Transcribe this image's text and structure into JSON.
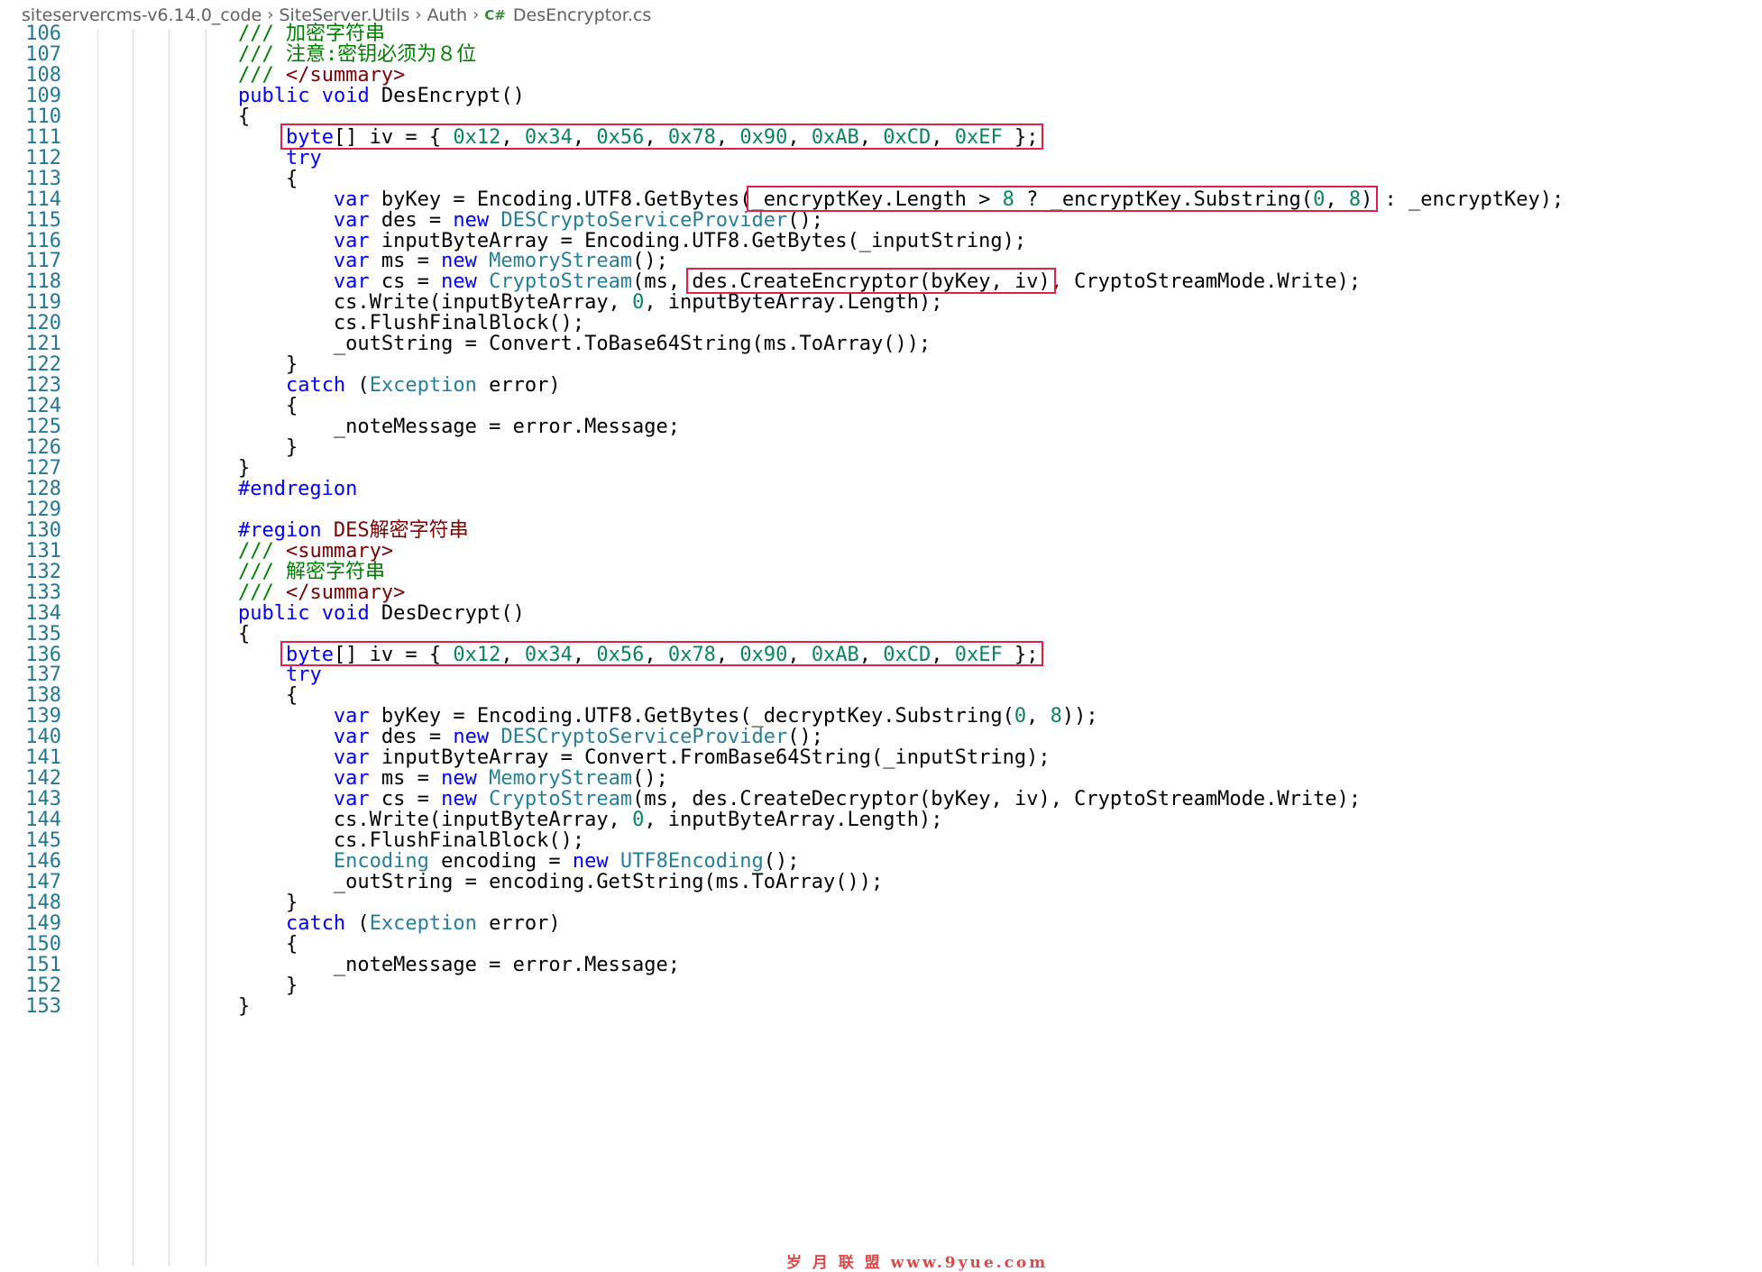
{
  "breadcrumb": {
    "items": [
      "siteservercms-v6.14.0_code",
      "SiteServer.Utils",
      "Auth"
    ],
    "file_icon": "C#",
    "file": "DesEncryptor.cs"
  },
  "colors": {
    "keyword": "#0000ff",
    "type": "#267f99",
    "comment": "#008000",
    "xml_tag": "#800000",
    "number": "#098658",
    "line_number": "#237893",
    "highlight_box": "#e3204a"
  },
  "lines": [
    {
      "n": "106",
      "t": [
        [
          "cm",
          "        /// 加密字符串"
        ]
      ]
    },
    {
      "n": "107",
      "t": [
        [
          "cm",
          "        /// 注意:密钥必须为８位"
        ]
      ]
    },
    {
      "n": "108",
      "t": [
        [
          "cm",
          "        /// "
        ],
        [
          "tag",
          "</summary>"
        ]
      ]
    },
    {
      "n": "109",
      "t": [
        [
          "p",
          "        "
        ],
        [
          "kw",
          "public"
        ],
        [
          "p",
          " "
        ],
        [
          "kw",
          "void"
        ],
        [
          "p",
          " DesEncrypt()"
        ]
      ]
    },
    {
      "n": "110",
      "t": [
        [
          "p",
          "        {"
        ]
      ]
    },
    {
      "n": "111",
      "t": [
        [
          "p",
          "            "
        ],
        [
          "kw",
          "byte"
        ],
        [
          "p",
          "[] iv = { "
        ],
        [
          "num",
          "0x12"
        ],
        [
          "p",
          ", "
        ],
        [
          "num",
          "0x34"
        ],
        [
          "p",
          ", "
        ],
        [
          "num",
          "0x56"
        ],
        [
          "p",
          ", "
        ],
        [
          "num",
          "0x78"
        ],
        [
          "p",
          ", "
        ],
        [
          "num",
          "0x90"
        ],
        [
          "p",
          ", "
        ],
        [
          "num",
          "0xAB"
        ],
        [
          "p",
          ", "
        ],
        [
          "num",
          "0xCD"
        ],
        [
          "p",
          ", "
        ],
        [
          "num",
          "0xEF"
        ],
        [
          "p",
          " };"
        ]
      ]
    },
    {
      "n": "112",
      "t": [
        [
          "p",
          "            "
        ],
        [
          "kw",
          "try"
        ]
      ]
    },
    {
      "n": "113",
      "t": [
        [
          "p",
          "            {"
        ]
      ]
    },
    {
      "n": "114",
      "t": [
        [
          "p",
          "                "
        ],
        [
          "kw",
          "var"
        ],
        [
          "p",
          " byKey = Encoding.UTF8.GetBytes(_encryptKey.Length > "
        ],
        [
          "num",
          "8"
        ],
        [
          "p",
          " ? _encryptKey.Substring("
        ],
        [
          "num",
          "0"
        ],
        [
          "p",
          ", "
        ],
        [
          "num",
          "8"
        ],
        [
          "p",
          ") : _encryptKey);"
        ]
      ]
    },
    {
      "n": "115",
      "t": [
        [
          "p",
          "                "
        ],
        [
          "kw",
          "var"
        ],
        [
          "p",
          " des = "
        ],
        [
          "kw",
          "new"
        ],
        [
          "p",
          " "
        ],
        [
          "cls",
          "DESCryptoServiceProvider"
        ],
        [
          "p",
          "();"
        ]
      ]
    },
    {
      "n": "116",
      "t": [
        [
          "p",
          "                "
        ],
        [
          "kw",
          "var"
        ],
        [
          "p",
          " inputByteArray = Encoding.UTF8.GetBytes(_inputString);"
        ]
      ]
    },
    {
      "n": "117",
      "t": [
        [
          "p",
          "                "
        ],
        [
          "kw",
          "var"
        ],
        [
          "p",
          " ms = "
        ],
        [
          "kw",
          "new"
        ],
        [
          "p",
          " "
        ],
        [
          "cls",
          "MemoryStream"
        ],
        [
          "p",
          "();"
        ]
      ]
    },
    {
      "n": "118",
      "t": [
        [
          "p",
          "                "
        ],
        [
          "kw",
          "var"
        ],
        [
          "p",
          " cs = "
        ],
        [
          "kw",
          "new"
        ],
        [
          "p",
          " "
        ],
        [
          "cls",
          "CryptoStream"
        ],
        [
          "p",
          "(ms, des.CreateEncryptor(byKey, iv), CryptoStreamMode.Write);"
        ]
      ]
    },
    {
      "n": "119",
      "t": [
        [
          "p",
          "                cs.Write(inputByteArray, "
        ],
        [
          "num",
          "0"
        ],
        [
          "p",
          ", inputByteArray.Length);"
        ]
      ]
    },
    {
      "n": "120",
      "t": [
        [
          "p",
          "                cs.FlushFinalBlock();"
        ]
      ]
    },
    {
      "n": "121",
      "t": [
        [
          "p",
          "                _outString = Convert.ToBase64String(ms.ToArray());"
        ]
      ]
    },
    {
      "n": "122",
      "t": [
        [
          "p",
          "            }"
        ]
      ]
    },
    {
      "n": "123",
      "t": [
        [
          "p",
          "            "
        ],
        [
          "kw",
          "catch"
        ],
        [
          "p",
          " ("
        ],
        [
          "cls",
          "Exception"
        ],
        [
          "p",
          " error)"
        ]
      ]
    },
    {
      "n": "124",
      "t": [
        [
          "p",
          "            {"
        ]
      ]
    },
    {
      "n": "125",
      "t": [
        [
          "p",
          "                _noteMessage = error.Message;"
        ]
      ]
    },
    {
      "n": "126",
      "t": [
        [
          "p",
          "            }"
        ]
      ]
    },
    {
      "n": "127",
      "t": [
        [
          "p",
          "        }"
        ]
      ]
    },
    {
      "n": "128",
      "t": [
        [
          "kw",
          "        #endregion"
        ]
      ]
    },
    {
      "n": "129",
      "t": [
        [
          "p",
          ""
        ]
      ]
    },
    {
      "n": "130",
      "t": [
        [
          "kw",
          "        #region"
        ],
        [
          "tag",
          " DES解密字符串"
        ]
      ]
    },
    {
      "n": "131",
      "t": [
        [
          "cm",
          "        /// "
        ],
        [
          "tag",
          "<summary>"
        ]
      ]
    },
    {
      "n": "132",
      "t": [
        [
          "cm",
          "        /// 解密字符串"
        ]
      ]
    },
    {
      "n": "133",
      "t": [
        [
          "cm",
          "        /// "
        ],
        [
          "tag",
          "</summary>"
        ]
      ]
    },
    {
      "n": "134",
      "t": [
        [
          "p",
          "        "
        ],
        [
          "kw",
          "public"
        ],
        [
          "p",
          " "
        ],
        [
          "kw",
          "void"
        ],
        [
          "p",
          " DesDecrypt()"
        ]
      ]
    },
    {
      "n": "135",
      "t": [
        [
          "p",
          "        {"
        ]
      ]
    },
    {
      "n": "136",
      "t": [
        [
          "p",
          "            "
        ],
        [
          "kw",
          "byte"
        ],
        [
          "p",
          "[] iv = { "
        ],
        [
          "num",
          "0x12"
        ],
        [
          "p",
          ", "
        ],
        [
          "num",
          "0x34"
        ],
        [
          "p",
          ", "
        ],
        [
          "num",
          "0x56"
        ],
        [
          "p",
          ", "
        ],
        [
          "num",
          "0x78"
        ],
        [
          "p",
          ", "
        ],
        [
          "num",
          "0x90"
        ],
        [
          "p",
          ", "
        ],
        [
          "num",
          "0xAB"
        ],
        [
          "p",
          ", "
        ],
        [
          "num",
          "0xCD"
        ],
        [
          "p",
          ", "
        ],
        [
          "num",
          "0xEF"
        ],
        [
          "p",
          " };"
        ]
      ]
    },
    {
      "n": "137",
      "t": [
        [
          "p",
          "            "
        ],
        [
          "kw",
          "try"
        ]
      ]
    },
    {
      "n": "138",
      "t": [
        [
          "p",
          "            {"
        ]
      ]
    },
    {
      "n": "139",
      "t": [
        [
          "p",
          "                "
        ],
        [
          "kw",
          "var"
        ],
        [
          "p",
          " byKey = Encoding.UTF8.GetBytes(_decryptKey.Substring("
        ],
        [
          "num",
          "0"
        ],
        [
          "p",
          ", "
        ],
        [
          "num",
          "8"
        ],
        [
          "p",
          "));"
        ]
      ]
    },
    {
      "n": "140",
      "t": [
        [
          "p",
          "                "
        ],
        [
          "kw",
          "var"
        ],
        [
          "p",
          " des = "
        ],
        [
          "kw",
          "new"
        ],
        [
          "p",
          " "
        ],
        [
          "cls",
          "DESCryptoServiceProvider"
        ],
        [
          "p",
          "();"
        ]
      ]
    },
    {
      "n": "141",
      "t": [
        [
          "p",
          "                "
        ],
        [
          "kw",
          "var"
        ],
        [
          "p",
          " inputByteArray = Convert.FromBase64String(_inputString);"
        ]
      ]
    },
    {
      "n": "142",
      "t": [
        [
          "p",
          "                "
        ],
        [
          "kw",
          "var"
        ],
        [
          "p",
          " ms = "
        ],
        [
          "kw",
          "new"
        ],
        [
          "p",
          " "
        ],
        [
          "cls",
          "MemoryStream"
        ],
        [
          "p",
          "();"
        ]
      ]
    },
    {
      "n": "143",
      "t": [
        [
          "p",
          "                "
        ],
        [
          "kw",
          "var"
        ],
        [
          "p",
          " cs = "
        ],
        [
          "kw",
          "new"
        ],
        [
          "p",
          " "
        ],
        [
          "cls",
          "CryptoStream"
        ],
        [
          "p",
          "(ms, des.CreateDecryptor(byKey, iv), CryptoStreamMode.Write);"
        ]
      ]
    },
    {
      "n": "144",
      "t": [
        [
          "p",
          "                cs.Write(inputByteArray, "
        ],
        [
          "num",
          "0"
        ],
        [
          "p",
          ", inputByteArray.Length);"
        ]
      ]
    },
    {
      "n": "145",
      "t": [
        [
          "p",
          "                cs.FlushFinalBlock();"
        ]
      ]
    },
    {
      "n": "146",
      "t": [
        [
          "p",
          "                "
        ],
        [
          "cls",
          "Encoding"
        ],
        [
          "p",
          " encoding = "
        ],
        [
          "kw",
          "new"
        ],
        [
          "p",
          " "
        ],
        [
          "cls",
          "UTF8Encoding"
        ],
        [
          "p",
          "();"
        ]
      ]
    },
    {
      "n": "147",
      "t": [
        [
          "p",
          "                _outString = encoding.GetString(ms.ToArray());"
        ]
      ]
    },
    {
      "n": "148",
      "t": [
        [
          "p",
          "            }"
        ]
      ]
    },
    {
      "n": "149",
      "t": [
        [
          "p",
          "            "
        ],
        [
          "kw",
          "catch"
        ],
        [
          "p",
          " ("
        ],
        [
          "cls",
          "Exception"
        ],
        [
          "p",
          " error)"
        ]
      ]
    },
    {
      "n": "150",
      "t": [
        [
          "p",
          "            {"
        ]
      ]
    },
    {
      "n": "151",
      "t": [
        [
          "p",
          "                _noteMessage = error.Message;"
        ]
      ]
    },
    {
      "n": "152",
      "t": [
        [
          "p",
          "            }"
        ]
      ]
    },
    {
      "n": "153",
      "t": [
        [
          "p",
          "        }"
        ]
      ]
    }
  ],
  "highlights": [
    {
      "line": "111",
      "text": "byte[] iv = { 0x12, 0x34, 0x56, 0x78, 0x90, 0xAB, 0xCD, 0xEF };"
    },
    {
      "line": "114",
      "text": "_encryptKey.Length > 8 ? _encryptKey.Substring(0, 8)"
    },
    {
      "line": "118",
      "text": "des.CreateEncryptor(byKey, iv)"
    },
    {
      "line": "136",
      "text": "byte[] iv = { 0x12, 0x34, 0x56, 0x78, 0x90, 0xAB, 0xCD, 0xEF };"
    }
  ],
  "watermark": "岁 月 联 盟  www.9yue.com"
}
